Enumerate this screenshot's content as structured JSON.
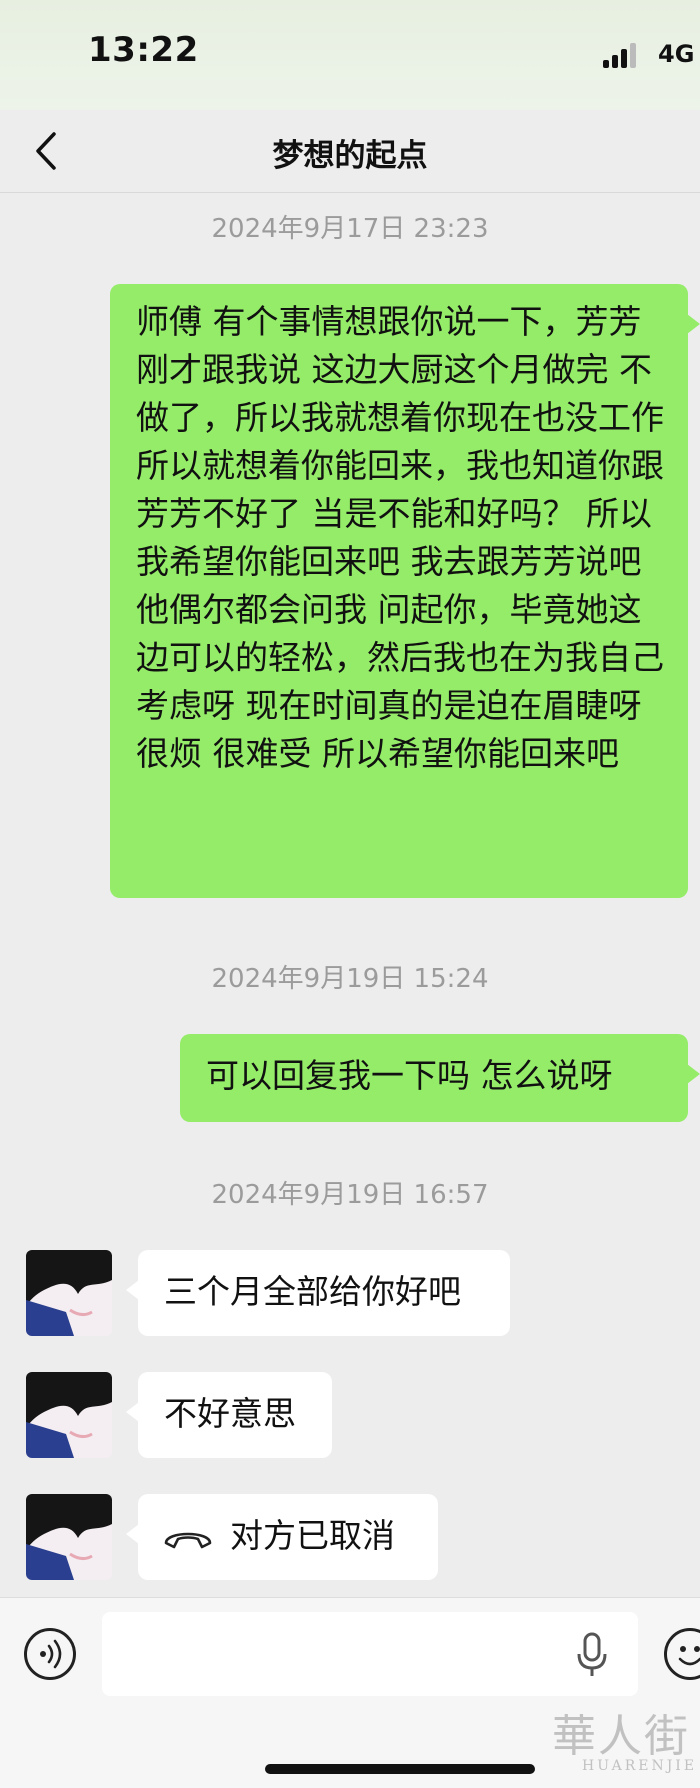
{
  "status_bar": {
    "time": "13:22",
    "network": "4G"
  },
  "nav": {
    "title": "梦想的起点"
  },
  "messages": [
    {
      "type": "timestamp",
      "text": "2024年9月17日 23:23"
    },
    {
      "type": "outgoing",
      "text": "师傅 有个事情想跟你说一下，芳芳刚才跟我说 这边大厨这个月做完 不做了，所以我就想着你现在也没工作 所以就想着你能回来，我也知道你跟芳芳不好了 当是不能和好吗？ 所以我希望你能回来吧 我去跟芳芳说吧 他偶尔都会问我 问起你，毕竟她这边可以的轻松，然后我也在为我自己考虑呀 现在时间真的是迫在眉睫呀 很烦 很难受 所以希望你能回来吧"
    },
    {
      "type": "timestamp",
      "text": "2024年9月19日 15:24"
    },
    {
      "type": "outgoing",
      "text": "可以回复我一下吗 怎么说呀"
    },
    {
      "type": "timestamp",
      "text": "2024年9月19日 16:57"
    },
    {
      "type": "incoming",
      "text": "三个月全部给你好吧"
    },
    {
      "type": "incoming",
      "text": "不好意思"
    },
    {
      "type": "incoming_call",
      "text": "对方已取消",
      "icon": "phone-hangup-icon"
    }
  ],
  "watermark": {
    "brand": "華人街",
    "sub": "HUARENJIE"
  },
  "colors": {
    "outgoing_bubble": "#95ec69",
    "incoming_bubble": "#ffffff",
    "background": "#ededed"
  }
}
